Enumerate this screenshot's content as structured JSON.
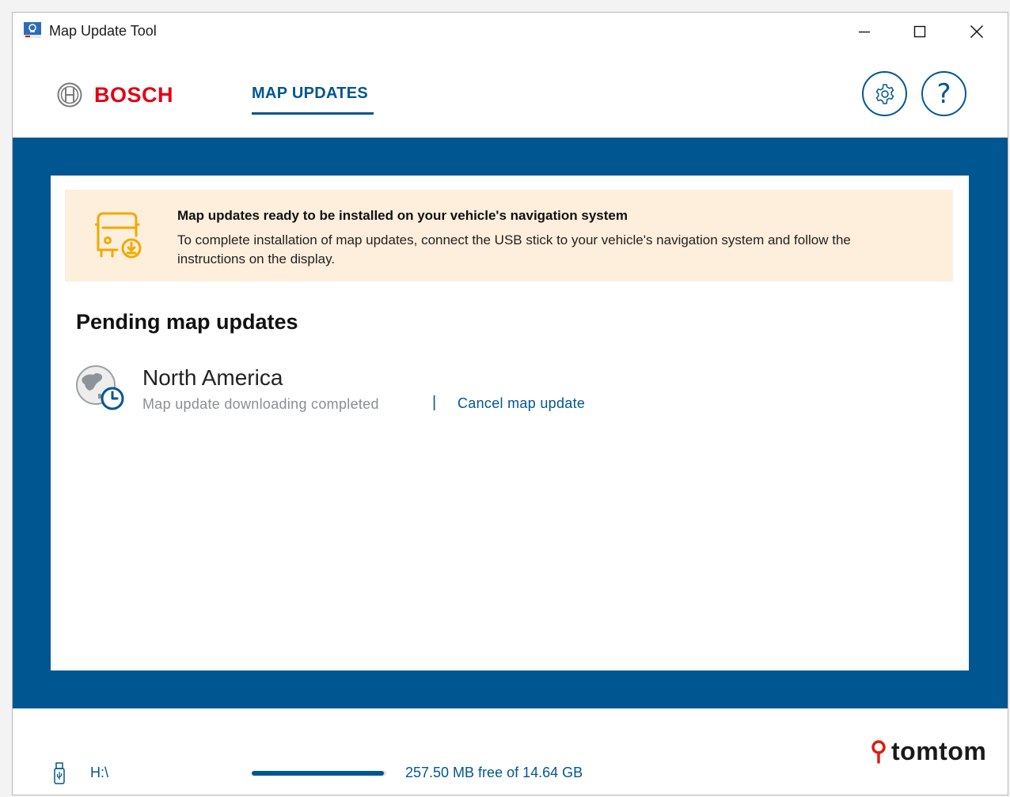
{
  "window": {
    "title": "Map Update Tool"
  },
  "header": {
    "brand": "BOSCH",
    "nav_tab": "MAP UPDATES",
    "help_glyph": "?"
  },
  "notice": {
    "title": "Map updates ready to be installed on your vehicle's navigation system",
    "body": "To complete installation of map updates, connect the USB stick to your vehicle's navigation system and follow the instructions on the display."
  },
  "pending": {
    "section_title": "Pending map updates",
    "items": [
      {
        "region": "North America",
        "status": "Map update downloading completed",
        "separator": "|",
        "cancel_label": "Cancel map update"
      }
    ]
  },
  "footer": {
    "drive": "H:\\",
    "storage_text": "257.50 MB free of 14.64 GB",
    "storage_used_fraction": 0.98,
    "partner_brand": "tomtom"
  },
  "icons": {
    "app": "app-icon",
    "minimize": "minimize-icon",
    "maximize": "maximize-icon",
    "close": "close-icon",
    "bosch_logo": "bosch-armature-logo",
    "settings": "gear-icon",
    "help": "question-mark-icon",
    "vehicle_download": "vehicle-download-icon",
    "region": "globe-clock-icon",
    "usb": "usb-stick-icon",
    "tomtom_pin": "location-pin-icon"
  },
  "colors": {
    "brand_blue": "#005691",
    "bosch_red": "#e20015",
    "notice_bg": "#fdefdc",
    "notice_icon": "#f2a900",
    "tomtom_red": "#df1b12"
  }
}
